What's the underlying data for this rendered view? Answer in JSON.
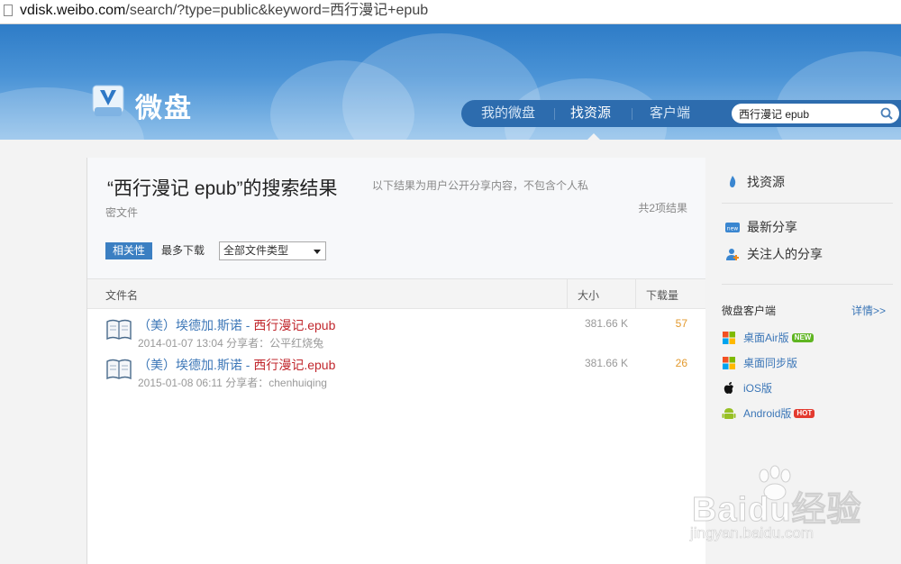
{
  "browser": {
    "url_domain": "vdisk.weibo.com",
    "url_rest": "/search/?type=public&keyword=西行漫记+epub"
  },
  "header": {
    "logo_text": "微盘",
    "nav": [
      "我的微盘",
      "找资源",
      "客户端"
    ],
    "search_value": "西行漫记 epub"
  },
  "results": {
    "title": "“西行漫记 epub”的搜索结果",
    "desc1": "以下结果为用户公开分享内容，不包含个人私",
    "desc2": "密文件",
    "count": "共2项结果",
    "sort_relevance": "相关性",
    "sort_downloads": "最多下载",
    "filetype_selected": "全部文件类型",
    "columns": {
      "name": "文件名",
      "size": "大小",
      "downloads": "下载量"
    },
    "rows": [
      {
        "name_prefix": "（美）埃德加.斯诺 - ",
        "name_highlight": "西行漫记",
        "name_ext": ".epub",
        "date": "2014-01-07 13:04",
        "sharer_label": "分享者：",
        "sharer": "公平红烧兔",
        "size": "381.66 K",
        "downloads": "57"
      },
      {
        "name_prefix": "（美）埃德加.斯诺 - ",
        "name_highlight": "西行漫记",
        "name_ext": ".epub",
        "date": "2015-01-08 06:11",
        "sharer_label": "分享者：",
        "sharer": "chenhuiqing",
        "size": "381.66 K",
        "downloads": "26"
      }
    ]
  },
  "sidebar": {
    "find": "找资源",
    "latest": "最新分享",
    "following": "关注人的分享",
    "client_title": "微盘客户端",
    "details": "详情>>",
    "clients": [
      {
        "label": "桌面Air版",
        "badge": "NEW"
      },
      {
        "label": "桌面同步版",
        "badge": ""
      },
      {
        "label": "iOS版",
        "badge": ""
      },
      {
        "label": "Android版",
        "badge": "HOT"
      }
    ]
  },
  "watermark": {
    "brand": "Baidu经验",
    "site": "jingyan.baidu.com"
  },
  "colors": {
    "header": "#3a87cf",
    "nav": "#2d6cae",
    "link": "#3b76b7",
    "highlight": "#c1272d",
    "downloads": "#e39a2e"
  }
}
